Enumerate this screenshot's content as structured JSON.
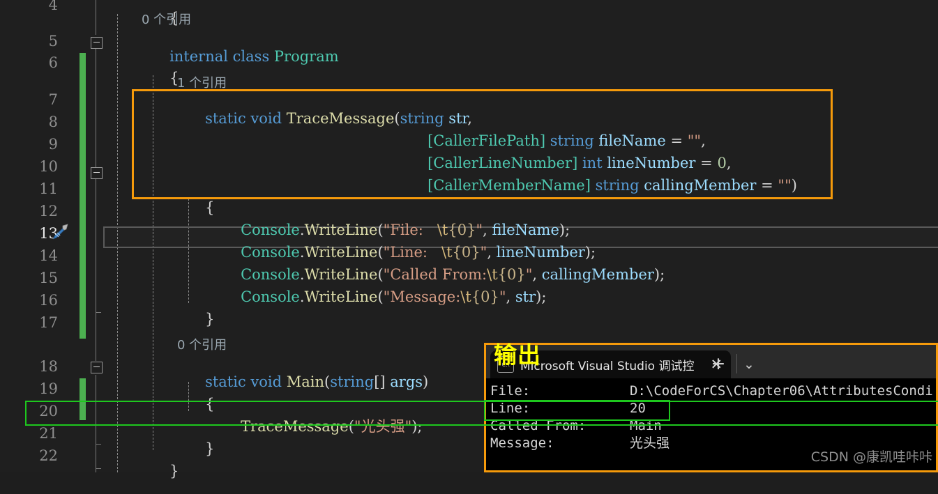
{
  "editor": {
    "background_color": "#1f1f1f",
    "line_numbers": [
      "4",
      "5",
      "6",
      "7",
      "8",
      "9",
      "10",
      "11",
      "12",
      "13",
      "14",
      "15",
      "16",
      "17",
      "18",
      "19",
      "20",
      "21",
      "22"
    ],
    "current_line_number": "13",
    "quick_actions_icon": "screwdriver-icon",
    "codelens": [
      {
        "text": "0 个引用"
      },
      {
        "text": "1 个引用"
      },
      {
        "text": "0 个引用"
      }
    ],
    "code_lines": [
      {
        "num": "4",
        "text": "{"
      },
      {
        "num": "5",
        "text": "internal class Program"
      },
      {
        "num": "6",
        "text": "{"
      },
      {
        "num": "7",
        "text": "static void TraceMessage(string str,"
      },
      {
        "num": "8",
        "text": "[CallerFilePath] string fileName = \"\","
      },
      {
        "num": "9",
        "text": "[CallerLineNumber] int lineNumber = 0,"
      },
      {
        "num": "10",
        "text": "[CallerMemberName] string callingMember = \"\")"
      },
      {
        "num": "11",
        "text": "{"
      },
      {
        "num": "12",
        "text": "Console.WriteLine(\"File:   \\t{0}\", fileName);"
      },
      {
        "num": "13",
        "text": "Console.WriteLine(\"Line:   \\t{0}\", lineNumber);"
      },
      {
        "num": "14",
        "text": "Console.WriteLine(\"Called From:\\t{0}\", callingMember);"
      },
      {
        "num": "15",
        "text": "Console.WriteLine(\"Message:\\t{0}\", str);"
      },
      {
        "num": "16",
        "text": "}"
      },
      {
        "num": "17",
        "text": ""
      },
      {
        "num": "18",
        "text": "static void Main(string[] args)"
      },
      {
        "num": "19",
        "text": "{"
      },
      {
        "num": "20",
        "text": "TraceMessage(\"光头强\");"
      },
      {
        "num": "21",
        "text": "}"
      },
      {
        "num": "22",
        "text": "}"
      }
    ],
    "tokens": {
      "line4_brace": "{",
      "line5_kw_internal": "internal",
      "line5_kw_class": "class",
      "line5_type_program": "Program",
      "line6_brace": "{",
      "line7_kw_static": "static",
      "line7_kw_void": "void",
      "line7_fn": "TraceMessage",
      "line7_paren": "(",
      "line7_kw_string": "string",
      "line7_var": "str",
      "line7_comma": ",",
      "line8_attr": "[CallerFilePath]",
      "line8_kw_string": "string",
      "line8_var": "fileName",
      "line8_eq": "=",
      "line8_str": "\"\"",
      "line8_comma": ",",
      "line9_attr": "[CallerLineNumber]",
      "line9_kw_int": "int",
      "line9_var": "lineNumber",
      "line9_eq": "=",
      "line9_num": "0",
      "line9_comma": ",",
      "line10_attr": "[CallerMemberName]",
      "line10_kw_string": "string",
      "line10_var": "callingMember",
      "line10_eq": "=",
      "line10_str": "\"\"",
      "line10_paren": ")",
      "line11_brace": "{",
      "line12_type": "Console",
      "line12_dot": ".",
      "line12_fn": "WriteLine",
      "line12_p1": "(",
      "line12_str": "\"File:   ",
      "line12_esc": "\\t",
      "line12_ph": "{0}",
      "line12_strend": "\"",
      "line12_sep": ", ",
      "line12_var": "fileName",
      "line12_end": ");",
      "line13_str": "\"Line:   ",
      "line13_var": "lineNumber",
      "line14_str": "\"Called From:",
      "line14_var": "callingMember",
      "line15_str": "\"Message:",
      "line15_var": "str",
      "line16_brace": "}",
      "line18_kw_static": "static",
      "line18_kw_void": "void",
      "line18_fn": "Main",
      "line18_kw_string": "string",
      "line18_brackets": "[]",
      "line18_var": "args",
      "line19_brace": "{",
      "line20_fn": "TraceMessage",
      "line20_str": "\"光头强\"",
      "line20_end": ");",
      "line21_brace": "}",
      "line22_brace": "}"
    },
    "colors": {
      "keyword": "#569CD6",
      "type": "#4EC9B0",
      "method": "#DCDCAA",
      "string": "#D69D85",
      "escape": "#D7BA7D",
      "number": "#B5CEA8",
      "variable": "#9CDCFE",
      "codelens": "#9AA7B0",
      "change_bar": "#4CAF50"
    }
  },
  "annotations": {
    "orange_color": "#F59A0B",
    "green_color": "#1EC81E",
    "yellow_label": "输出",
    "yellow_color": "#FFFF00"
  },
  "output_panel": {
    "tab": {
      "icon": "console-window-icon",
      "title": "Microsoft Visual Studio 调试控",
      "close_label": "✕"
    },
    "new_tab_label": "+",
    "chevron_label": "⌄",
    "rows": [
      {
        "label": "File:",
        "value": "D:\\CodeForCS\\Chapter06\\AttributesCondi"
      },
      {
        "label": "Line:",
        "value": "20"
      },
      {
        "label": "Called From:",
        "value": "Main"
      },
      {
        "label": "Message:",
        "value": "光头强"
      }
    ]
  },
  "watermark": {
    "text": "CSDN @康凯哇咔咔"
  }
}
